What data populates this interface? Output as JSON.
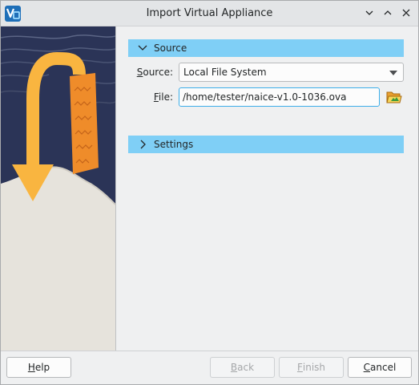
{
  "window": {
    "title": "Import Virtual Appliance",
    "controls": {
      "minimize_icon": "chevron-down-icon",
      "maximize_icon": "chevron-up-icon",
      "close_icon": "close-icon"
    }
  },
  "sections": {
    "source": {
      "label": "Source",
      "expanded": true
    },
    "settings": {
      "label": "Settings",
      "expanded": false
    }
  },
  "source_form": {
    "source_label_mnemonic": "S",
    "source_label_rest": "ource:",
    "source_value": "Local File System",
    "file_label_mnemonic": "F",
    "file_label_rest": "ile:",
    "file_value": "/home/tester/naice-v1.0-1036.ova"
  },
  "buttons": {
    "help": {
      "mnemonic": "H",
      "rest": "elp",
      "enabled": true
    },
    "back": {
      "mnemonic": "B",
      "rest": "ack",
      "enabled": false
    },
    "finish": {
      "mnemonic": "F",
      "rest": "inish",
      "enabled": false
    },
    "cancel": {
      "mnemonic": "C",
      "rest": "ancel",
      "enabled": true
    }
  },
  "colors": {
    "section_header": "#7fcff6",
    "focus_border": "#3daee9",
    "sidebar_dark": "#2b3457",
    "arrow_yellow": "#f9b540",
    "arrow_orange": "#ef8c2a",
    "snow": "#e6e3dc"
  }
}
